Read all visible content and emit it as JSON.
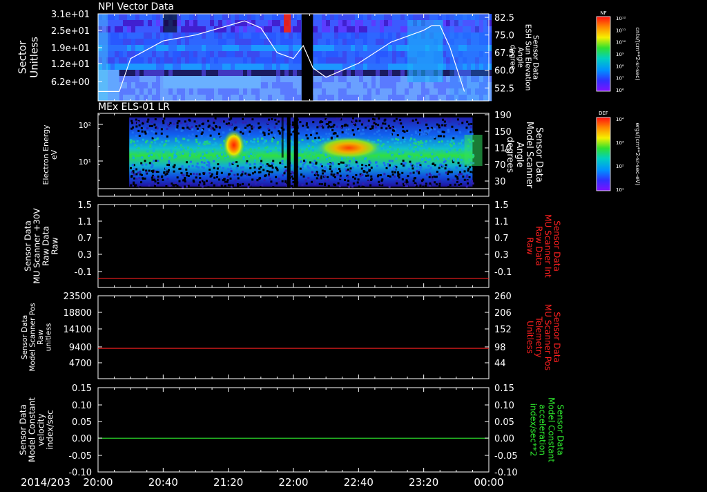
{
  "date_label": "2014/203",
  "time_ticks": [
    "20:00",
    "20:40",
    "21:20",
    "22:00",
    "22:40",
    "23:20",
    "00:00"
  ],
  "colors": {
    "white": "#ffffff",
    "red": "#ff2020",
    "green": "#2ee82e"
  },
  "chart_data": [
    {
      "type": "heatmap",
      "title": "NPI Vector Data",
      "ylabel_left": [
        "Sector",
        "Unitless"
      ],
      "yticks_left": [
        "3.1e+01",
        "2.5e+01",
        "1.9e+01",
        "1.2e+01",
        "6.2e+00"
      ],
      "ylabel_right": [
        "Sensor Data",
        "ESH Sun Elevation",
        "Angle",
        "degree"
      ],
      "yticks_right": [
        "82.5",
        "75.0",
        "67.5",
        "60.0",
        "52.5"
      ],
      "right_ylim": [
        47,
        84
      ],
      "data_gap": [
        "22:05",
        "22:12"
      ],
      "overlay_line": {
        "name": "ESH Sun Elevation Angle",
        "color": "#ffffff",
        "x": [
          "20:00",
          "20:13",
          "20:20",
          "20:40",
          "21:00",
          "21:20",
          "21:30",
          "21:40",
          "21:50",
          "22:00",
          "22:06",
          "22:12",
          "22:20",
          "22:40",
          "23:00",
          "23:20",
          "23:25",
          "23:30",
          "23:36",
          "23:45"
        ],
        "y": [
          51,
          51,
          65,
          72.5,
          75,
          79,
          81,
          78,
          67.5,
          65,
          70.5,
          61,
          57,
          63,
          72,
          77,
          79,
          79,
          70,
          51
        ]
      },
      "colorbar": {
        "title": "NF",
        "units": "cnts/(cm**2-sr-sec)",
        "tick_labels": [
          "10¹²",
          "10¹¹",
          "10¹⁰",
          "10⁹",
          "10⁸",
          "10⁷",
          "10⁶"
        ]
      }
    },
    {
      "type": "heatmap",
      "title": "MEx ELS-01 LR",
      "ylabel_left": [
        "Electron Energy",
        "eV"
      ],
      "yticks_left": [
        "10²",
        "10¹"
      ],
      "ylabel_right": [
        "Sensor Data",
        "Model Scanner",
        "Angle",
        "degrees"
      ],
      "yticks_right": [
        "190",
        "150",
        "110",
        "70",
        "30"
      ],
      "hot_spots": [
        "21:20",
        "22:40"
      ],
      "colorbar": {
        "title": "DEF",
        "units": "ergs/(cm**2-sr-sec-eV)",
        "tick_labels": [
          "10⁴",
          "10³",
          "10²",
          "10¹"
        ]
      }
    },
    {
      "type": "line",
      "ylabel_left": [
        "Sensor Data",
        "MU Scanner +30V",
        "Raw Data",
        "Raw"
      ],
      "yticks_left": [
        "1.5",
        "1.1",
        "0.7",
        "0.3",
        "-0.1"
      ],
      "ylabel_right": [
        "Sensor Data",
        "MU Scanner Int",
        "Raw Data",
        "Raw"
      ],
      "yticks_right": [
        "1.5",
        "1.1",
        "0.7",
        "0.3",
        "-0.1"
      ],
      "ylim": [
        -0.3,
        1.5
      ],
      "series": [
        {
          "color": "#ff2020",
          "value": -0.1
        }
      ]
    },
    {
      "type": "line",
      "ylabel_left": [
        "Sensor Data",
        "Model Scanner Pos",
        "Raw",
        "unitless"
      ],
      "yticks_left": [
        "23500",
        "18800",
        "14100",
        "9400",
        "4700"
      ],
      "ylabel_right": [
        "Sensor Data",
        "MU Scanner Pos",
        "Telemetry",
        "Unitless"
      ],
      "yticks_right": [
        "260",
        "206",
        "152",
        "98",
        "44"
      ],
      "ylim": [
        0,
        23500
      ],
      "series": [
        {
          "color": "#ff2020",
          "value": 8600
        }
      ]
    },
    {
      "type": "line",
      "ylabel_left": [
        "Sensor Data",
        "Model Constant",
        "velocity",
        "index/sec"
      ],
      "yticks_left": [
        "0.15",
        "0.10",
        "0.05",
        "0.00",
        "-0.05",
        "-0.10"
      ],
      "ylabel_right": [
        "Sensor Data",
        "Model Constant",
        "acceleration",
        "index/sec**2"
      ],
      "yticks_right": [
        "0.15",
        "0.10",
        "0.05",
        "0.00",
        "-0.05",
        "-0.10"
      ],
      "ylim": [
        -0.1,
        0.15
      ],
      "series": [
        {
          "color": "#2ee82e",
          "value": 0.0
        }
      ]
    }
  ]
}
